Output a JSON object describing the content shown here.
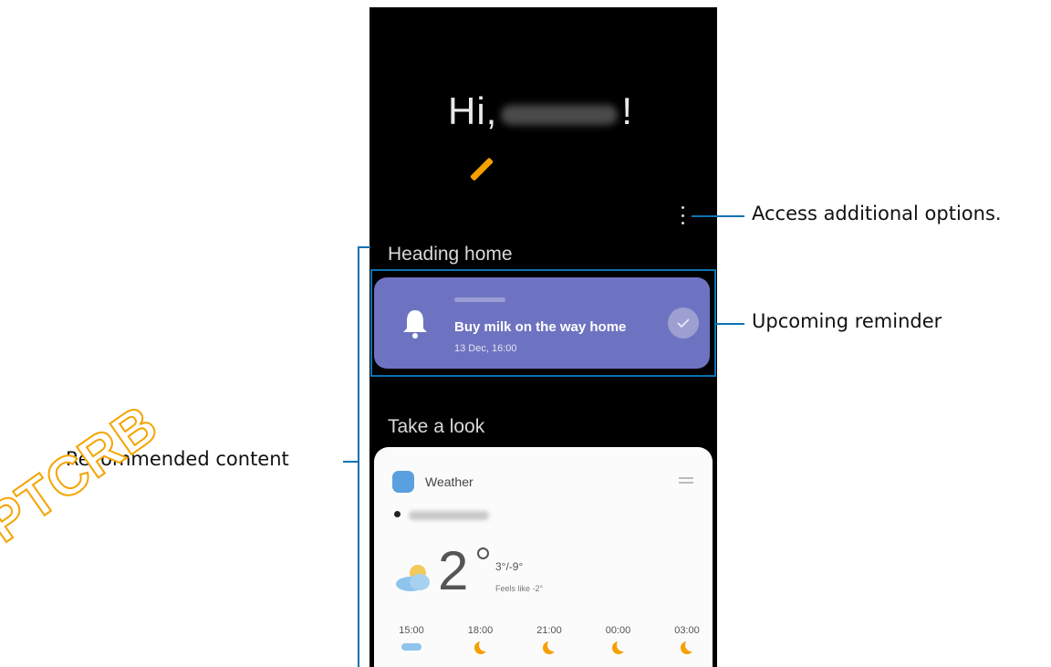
{
  "greeting": {
    "prefix": "Hi,",
    "suffix": "!"
  },
  "sections": {
    "heading_home": "Heading home",
    "take_a_look": "Take a look"
  },
  "reminder": {
    "title": "Buy milk on the way home",
    "time": "13 Dec, 16:00"
  },
  "weather": {
    "title": "Weather",
    "temperature": "2",
    "hilo": "3°/-9°",
    "feels_like": "Feels like -2°",
    "hours": [
      {
        "time": "15:00",
        "icon": "cloud-icon"
      },
      {
        "time": "18:00",
        "icon": "moon-icon"
      },
      {
        "time": "21:00",
        "icon": "moon-icon"
      },
      {
        "time": "00:00",
        "icon": "moon-icon"
      },
      {
        "time": "03:00",
        "icon": "moon-icon"
      }
    ]
  },
  "annotations": {
    "options": "Access additional options.",
    "reminder": "Upcoming reminder",
    "recommended": "Recommended content"
  },
  "watermark": "PTCRB",
  "colors": {
    "accent": "#f5a000",
    "callout_line": "#0c72b5",
    "reminder_card": "#6e73c1"
  }
}
